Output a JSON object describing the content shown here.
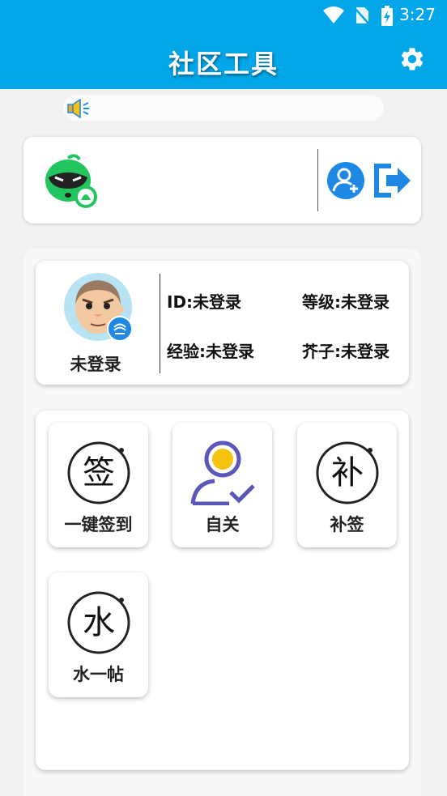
{
  "status_bar": {
    "time": "3:27",
    "icons": [
      "wifi-icon",
      "no-sim-icon",
      "battery-charging-icon"
    ]
  },
  "app_bar": {
    "title": "社区工具",
    "settings_icon": "gear-icon"
  },
  "notice": {
    "icon": "speaker-icon",
    "text": ""
  },
  "account": {
    "logo_icon": "community-logo-icon",
    "add_user_icon": "add-user-icon",
    "logout_icon": "logout-icon"
  },
  "profile": {
    "name": "未登录",
    "id": "ID:未登录",
    "level": "等级:未登录",
    "exp": "经验:未登录",
    "mustard": "芥子:未登录"
  },
  "tools": [
    {
      "label": "一键签到",
      "icon_char": "签",
      "icon": "sign-in-icon"
    },
    {
      "label": "自关",
      "icon_char": "",
      "icon": "user-check-icon"
    },
    {
      "label": "补签",
      "icon_char": "补",
      "icon": "makeup-sign-icon"
    },
    {
      "label": "水一帖",
      "icon_char": "水",
      "icon": "water-post-icon"
    }
  ],
  "colors": {
    "primary": "#03a6e9",
    "accent_blue": "#1e88e5",
    "green": "#22c55e",
    "purple": "#5b57b8",
    "gold": "#f4c30f"
  }
}
